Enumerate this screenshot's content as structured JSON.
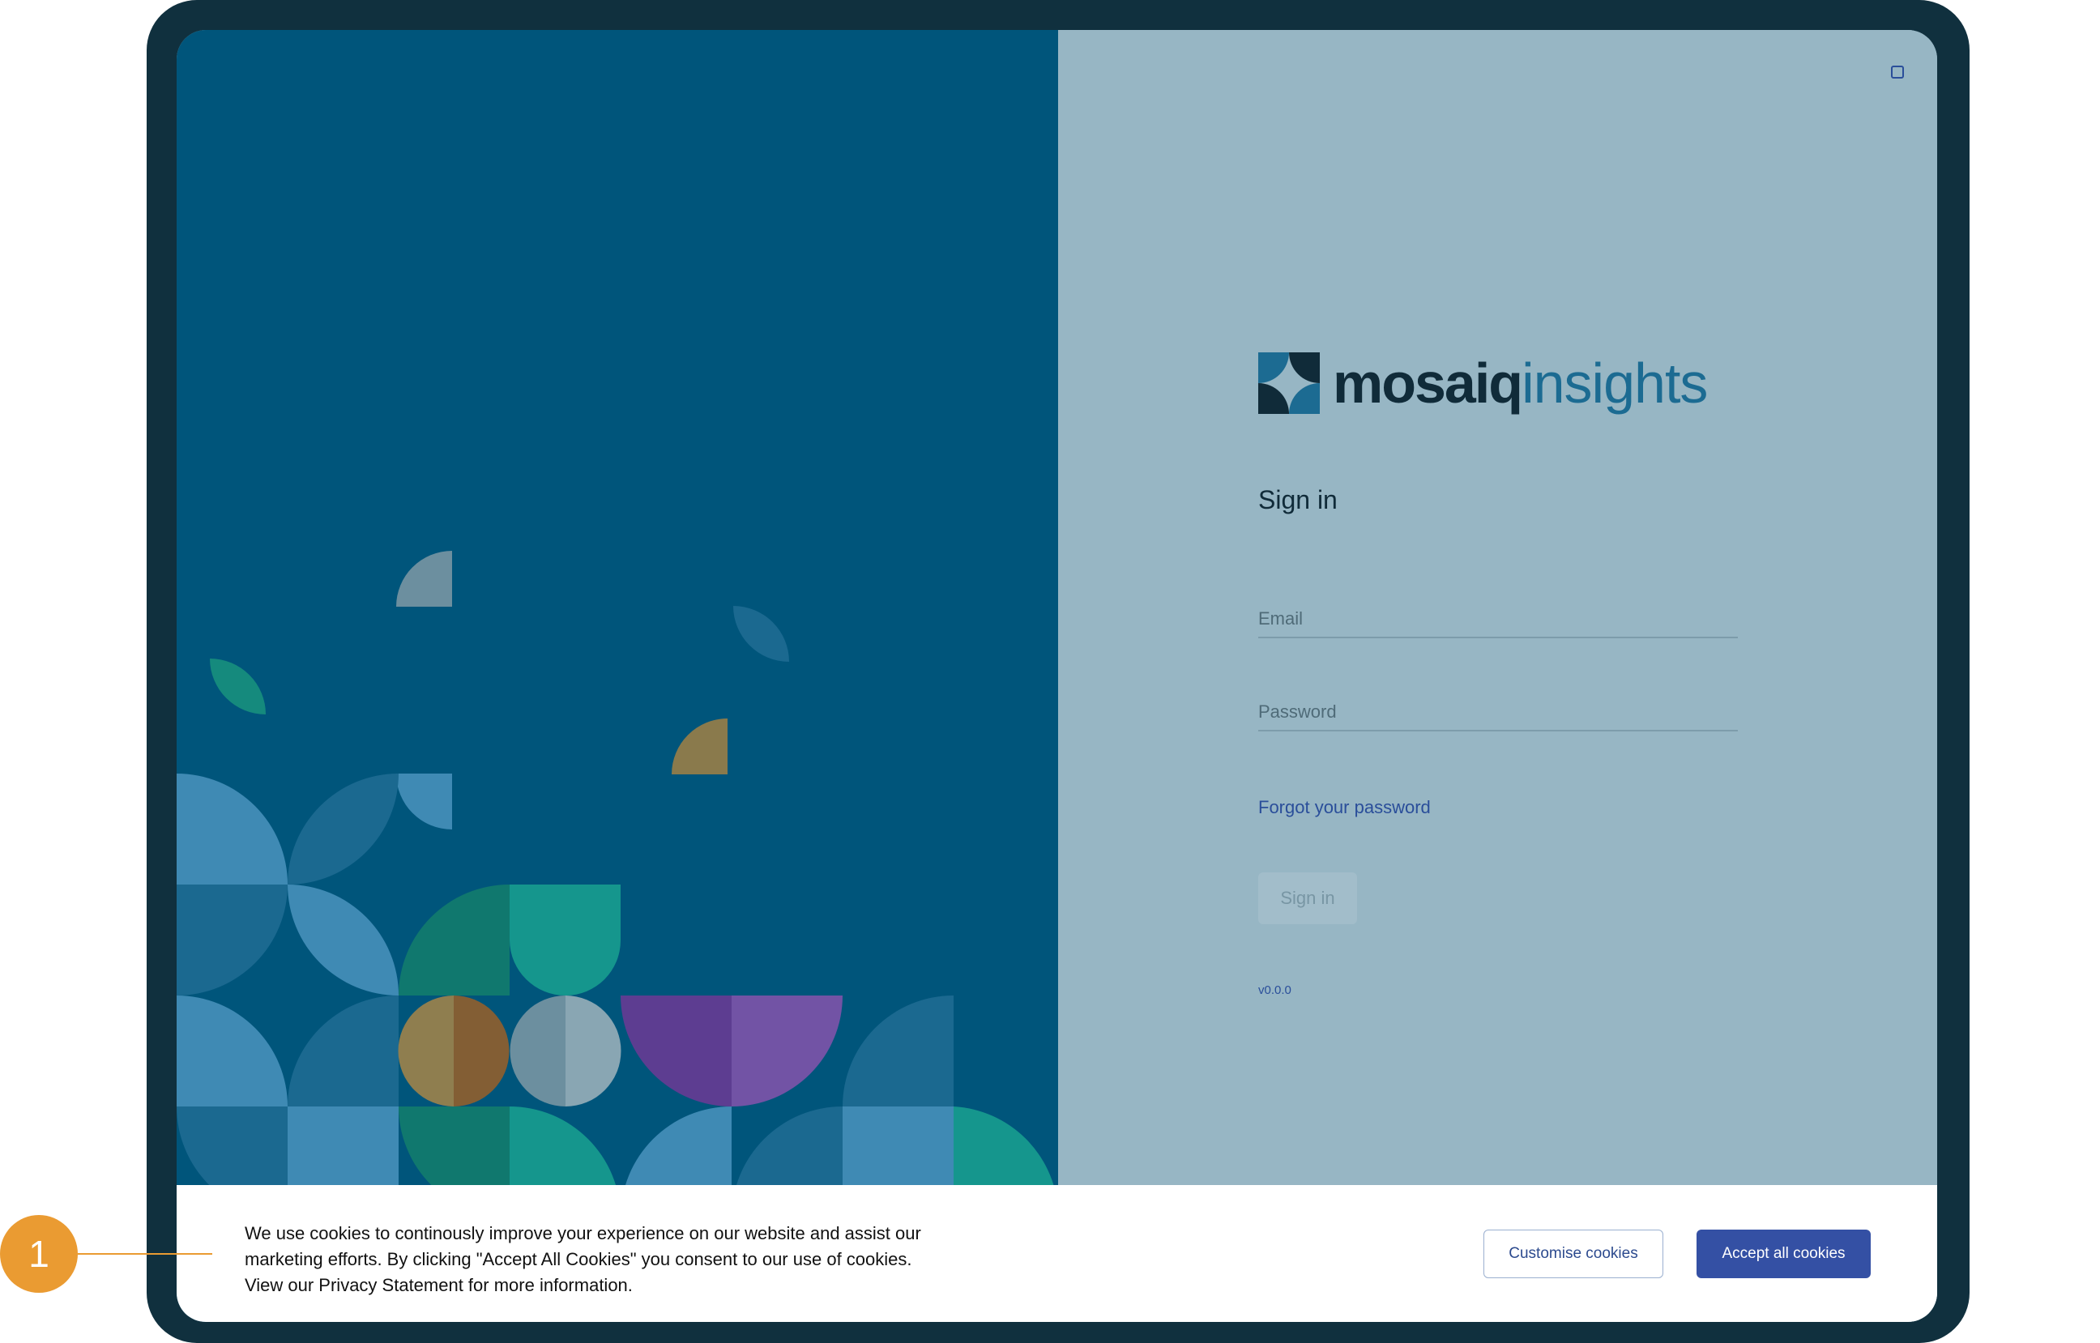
{
  "login": {
    "brand_primary": "mosaiq",
    "brand_secondary": "insights",
    "title": "Sign in",
    "email_placeholder": "Email",
    "password_placeholder": "Password",
    "forgot_link": "Forgot your password",
    "signin_button": "Sign in",
    "version": "v0.0.0"
  },
  "cookie_banner": {
    "text_lines": [
      "We use cookies to continously improve your experience on our website and assist our",
      "marketing efforts. By clicking \"Accept All Cookies\" you consent to our use of cookies.",
      "View our Privacy Statement for more information."
    ],
    "customise_button": "Customise cookies",
    "accept_button": "Accept all cookies"
  },
  "annotation": {
    "callout_number": "1"
  },
  "colors": {
    "frame": "#10303e",
    "left_panel": "#00557b",
    "right_panel": "#97b6c4",
    "accent_blue": "#3450a4",
    "callout_orange": "#ea9b32",
    "brand_teal": "#1c6b92"
  },
  "icons": {
    "logo_mark": "four-petal-diamond-icon",
    "corner_square": "square-outline-icon"
  }
}
